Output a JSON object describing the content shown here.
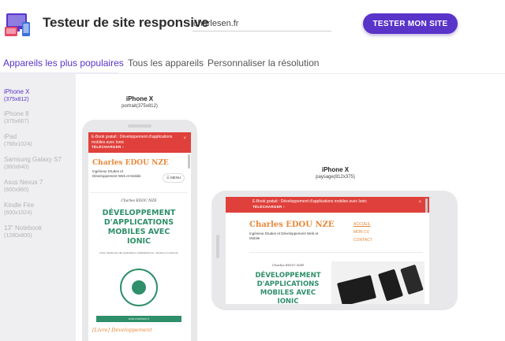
{
  "header": {
    "title": "Testeur de site responsive",
    "url_value": "charlesen.fr",
    "test_button": "TESTER MON SITE"
  },
  "tabs": [
    {
      "label": "Appareils les plus populaires",
      "active": true
    },
    {
      "label": "Tous les appareils",
      "active": false
    },
    {
      "label": "Personnaliser la résolution",
      "active": false
    }
  ],
  "sidebar": {
    "devices": [
      {
        "name": "iPhone X",
        "res": "(375x812)",
        "active": true
      },
      {
        "name": "iPhone 8",
        "res": "(375x667)",
        "active": false
      },
      {
        "name": "iPad",
        "res": "(768x1024)",
        "active": false
      },
      {
        "name": "Samsung Galaxy S7",
        "res": "(360x640)",
        "active": false
      },
      {
        "name": "Asus Nexus 7",
        "res": "(600x960)",
        "active": false
      },
      {
        "name": "Kindle Fire",
        "res": "(600x1024)",
        "active": false
      },
      {
        "name": "13\" Notebook",
        "res": "(1280x800)",
        "active": false
      }
    ]
  },
  "previews": {
    "portrait": {
      "name": "iPhone X",
      "sub": "portrait(375x812)"
    },
    "landscape": {
      "name": "iPhone X",
      "sub": "paysage(812x375)"
    }
  },
  "site": {
    "banner_text": "E-Book gratuit : Développement d'applications mobiles avec Ionic",
    "banner_download": "TÉLÉCHARGER ›",
    "banner_close": "×",
    "name": "Charles EDOU NZE",
    "tagline": "Ingénieur Etudes et Développement Web et Mobile",
    "menu_label": "☰ MENU",
    "nav": [
      "ACCUEIL",
      "MON CV",
      "CONTACT"
    ],
    "book_author": "Charles EDOU NZE",
    "book_title": "Développement d'applications mobiles avec Ionic",
    "book_subtitle": "Créez rapidement des applications multiplateformes, robustes et modernes",
    "book_url": "www.charlesen.fr",
    "article_link": "[Livre] Développement"
  },
  "colors": {
    "accent": "#5a33c9",
    "banner": "#e0403b",
    "site_orange": "#e8883a",
    "book_green": "#2f8f6a"
  }
}
